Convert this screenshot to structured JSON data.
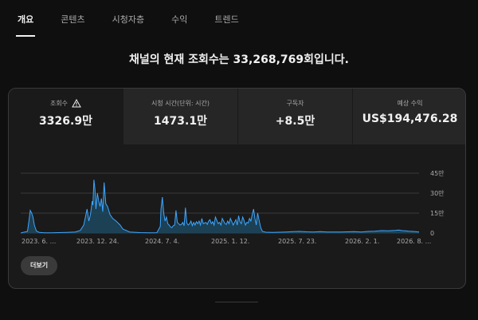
{
  "tabs": [
    {
      "label": "개요",
      "active": true
    },
    {
      "label": "콘텐츠",
      "active": false
    },
    {
      "label": "시청자층",
      "active": false
    },
    {
      "label": "수익",
      "active": false
    },
    {
      "label": "트렌드",
      "active": false
    }
  ],
  "headline": "채널의 현재 조회수는 33,268,769회입니다.",
  "metrics": [
    {
      "label": "조회수",
      "value": "3326.9만",
      "warning_icon": "warning-icon"
    },
    {
      "label": "시청 시간(단위: 시간)",
      "value": "1473.1만"
    },
    {
      "label": "구독자",
      "value": "+8.5만"
    },
    {
      "label": "예상 수익",
      "value": "US$194,476.28"
    }
  ],
  "more_button": "더보기",
  "colors": {
    "line": "#3ea6ff",
    "fill": "#1d4a63",
    "grid": "#3a3a3a",
    "text": "#aaaaaa"
  },
  "chart_data": {
    "type": "area",
    "x_tick_labels": [
      "2023. 6. ...",
      "2023. 12. 24.",
      "2024. 7. 4.",
      "2025. 1. 12.",
      "2025. 7. 23.",
      "2026. 2. 1.",
      "2026. 8. ..."
    ],
    "y_tick_labels": [
      "0",
      "15만",
      "30만",
      "45만"
    ],
    "ylim": [
      0,
      450000
    ],
    "x_range_days": [
      0,
      1170
    ],
    "grid": true,
    "series": [
      {
        "x": [
          0,
          12,
          20,
          24,
          28,
          32,
          36,
          40,
          46,
          55,
          70,
          90,
          110,
          135,
          160,
          175,
          185,
          190,
          195,
          200,
          205,
          210,
          212,
          215,
          218,
          221,
          225,
          229,
          233,
          237,
          241,
          245,
          250,
          255,
          262,
          270,
          280,
          292,
          300,
          320,
          350,
          380,
          400,
          410,
          412,
          416,
          420,
          424,
          428,
          432,
          436,
          440,
          444,
          448,
          452,
          456,
          460,
          464,
          468,
          472,
          476,
          480,
          484,
          488,
          492,
          496,
          500,
          504,
          508,
          512,
          516,
          520,
          524,
          528,
          532,
          536,
          540,
          544,
          548,
          552,
          556,
          560,
          564,
          568,
          572,
          576,
          580,
          584,
          588,
          592,
          596,
          600,
          604,
          608,
          612,
          616,
          620,
          624,
          628,
          632,
          636,
          640,
          644,
          648,
          652,
          656,
          660,
          664,
          668,
          672,
          676,
          680,
          684,
          688,
          692,
          696,
          700,
          705,
          710,
          720,
          740,
          760,
          780,
          800,
          820,
          840,
          860,
          880,
          900,
          920,
          940,
          960,
          980,
          1000,
          1020,
          1040,
          1060,
          1080,
          1100,
          1110,
          1120,
          1130,
          1140,
          1150,
          1160,
          1170
        ],
        "y": [
          0,
          8000,
          12000,
          90000,
          170000,
          150000,
          120000,
          60000,
          15000,
          4000,
          2000,
          2000,
          3000,
          5000,
          8000,
          20000,
          60000,
          120000,
          180000,
          90000,
          140000,
          240000,
          210000,
          400000,
          330000,
          180000,
          300000,
          240000,
          200000,
          260000,
          160000,
          380000,
          220000,
          200000,
          140000,
          110000,
          90000,
          60000,
          30000,
          8000,
          3000,
          2000,
          2500,
          50000,
          180000,
          270000,
          150000,
          90000,
          120000,
          70000,
          60000,
          45000,
          40000,
          55000,
          60000,
          170000,
          80000,
          70000,
          60000,
          65000,
          80000,
          55000,
          190000,
          75000,
          60000,
          70000,
          90000,
          55000,
          80000,
          60000,
          85000,
          70000,
          90000,
          60000,
          110000,
          70000,
          75000,
          80000,
          65000,
          90000,
          100000,
          70000,
          85000,
          60000,
          120000,
          95000,
          70000,
          80000,
          60000,
          110000,
          90000,
          70000,
          65000,
          90000,
          70000,
          110000,
          85000,
          60000,
          80000,
          100000,
          60000,
          130000,
          85000,
          70000,
          120000,
          95000,
          60000,
          80000,
          75000,
          110000,
          90000,
          140000,
          180000,
          110000,
          60000,
          150000,
          100000,
          40000,
          12000,
          6000,
          5000,
          6000,
          8000,
          10000,
          12000,
          9000,
          8000,
          10000,
          7000,
          8000,
          7000,
          9000,
          10000,
          8000,
          12000,
          14000,
          18000,
          16000,
          20000,
          22000,
          18000,
          16000,
          14000,
          12000,
          10000,
          8000
        ]
      }
    ]
  }
}
